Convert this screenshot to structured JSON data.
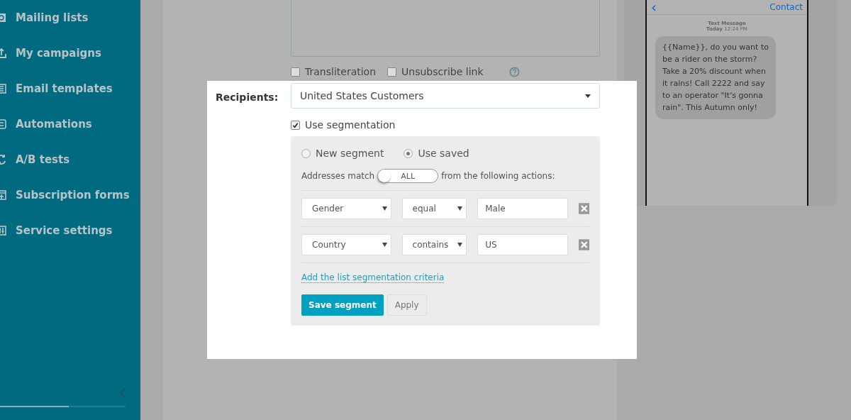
{
  "sidebar": {
    "items": [
      {
        "label": "Mailing lists"
      },
      {
        "label": "My campaigns"
      },
      {
        "label": "Email templates"
      },
      {
        "label": "Automations"
      },
      {
        "label": "A/B tests"
      },
      {
        "label": "Subscription forms"
      },
      {
        "label": "Service settings"
      }
    ],
    "progress": {
      "level": 0.55
    }
  },
  "message_options": [
    {
      "label": "Transliteration",
      "checked": false
    },
    {
      "label": "Unsubscribe link",
      "checked": false
    }
  ],
  "recipients": {
    "label": "Recipients:",
    "value": "United States Customers"
  },
  "use_segmentation": {
    "label": "Use segmentation",
    "checked": true
  },
  "segment": {
    "modes": [
      {
        "label": "New segment",
        "selected": false
      },
      {
        "label": "Use saved",
        "selected": true
      }
    ],
    "match_before": "Addresses match",
    "match_toggle": "ALL",
    "match_after": "from the following actions:",
    "conditions": [
      {
        "field": "Gender",
        "operator": "equal",
        "value": "Male"
      },
      {
        "field": "Country",
        "operator": "contains",
        "value": "US"
      }
    ],
    "add_link": "Add the list segmentation criteria",
    "buttons": [
      {
        "label": "Save segment",
        "kind": "primary"
      },
      {
        "label": "Apply",
        "kind": "secondary"
      }
    ]
  },
  "preview": {
    "back": "‹",
    "contact": "Contact",
    "header": "Text Message",
    "time_prefix": "Today",
    "time": "12:24 PM",
    "message": " {{Name}}, do you want to be a rider on the storm? Take a 20% discount when it rains! Call 2222 and say to an operator \"It's gonna rain\". This Autumn only!"
  }
}
